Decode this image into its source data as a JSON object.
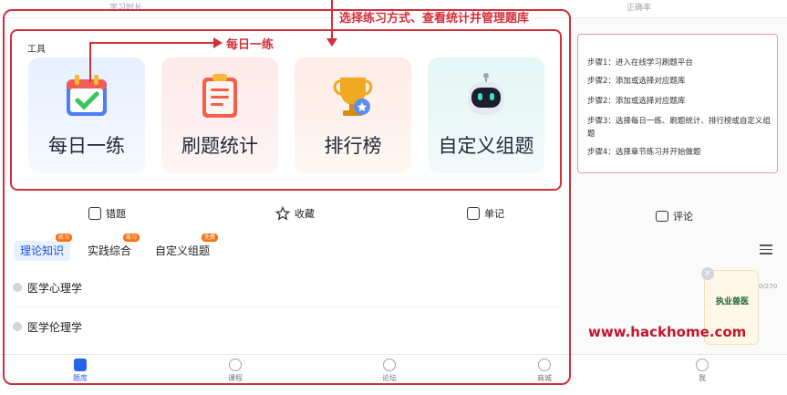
{
  "top": {
    "left_label": "学习时长",
    "right_label": "正确率"
  },
  "annotation": {
    "title_line1": "...",
    "title_line2": "选择练习方式、查看统计并管理题库",
    "daily": "每日一练"
  },
  "tools": {
    "label": "工具",
    "cards": [
      {
        "label": "每日一练",
        "icon": "calendar-check-icon"
      },
      {
        "label": "刷题统计",
        "icon": "clipboard-list-icon"
      },
      {
        "label": "排行榜",
        "icon": "trophy-icon"
      },
      {
        "label": "自定义组题",
        "icon": "robot-icon"
      }
    ]
  },
  "quick_tabs": [
    {
      "label": "错题",
      "icon": "wrong-questions-icon"
    },
    {
      "label": "收藏",
      "icon": "star-icon"
    },
    {
      "label": "单记",
      "icon": "notebook-icon"
    }
  ],
  "categories": [
    {
      "label": "理论知识",
      "badge": "练习"
    },
    {
      "label": "实践综合",
      "badge": "练习"
    },
    {
      "label": "自定义组题",
      "badge": "免费"
    }
  ],
  "list": [
    "医学心理学",
    "医学伦理学"
  ],
  "bottom_nav": [
    {
      "label": "题库",
      "icon": "question-bank-icon"
    },
    {
      "label": "课程",
      "icon": "course-icon"
    },
    {
      "label": "论坛",
      "icon": "forum-icon"
    },
    {
      "label": "商城",
      "icon": "shop-icon"
    }
  ],
  "right_panel": {
    "steps": [
      "步骤1：进入在线学习刷题平台",
      "步骤2：添加或选择对应题库",
      "步骤2：添加或选择对应题库",
      "步骤3：选择每日一练、刷题统计、排行榜或自定义组题",
      "步骤4：选择章节练习并开始做题"
    ],
    "comment_tab": "评论",
    "promo_text": "执业兽医",
    "page_count": "0/270",
    "watermark": "www.hackhome.com",
    "nav_me": "我"
  },
  "colors": {
    "annotation_red": "#d32f3a",
    "active_blue": "#2563eb"
  }
}
